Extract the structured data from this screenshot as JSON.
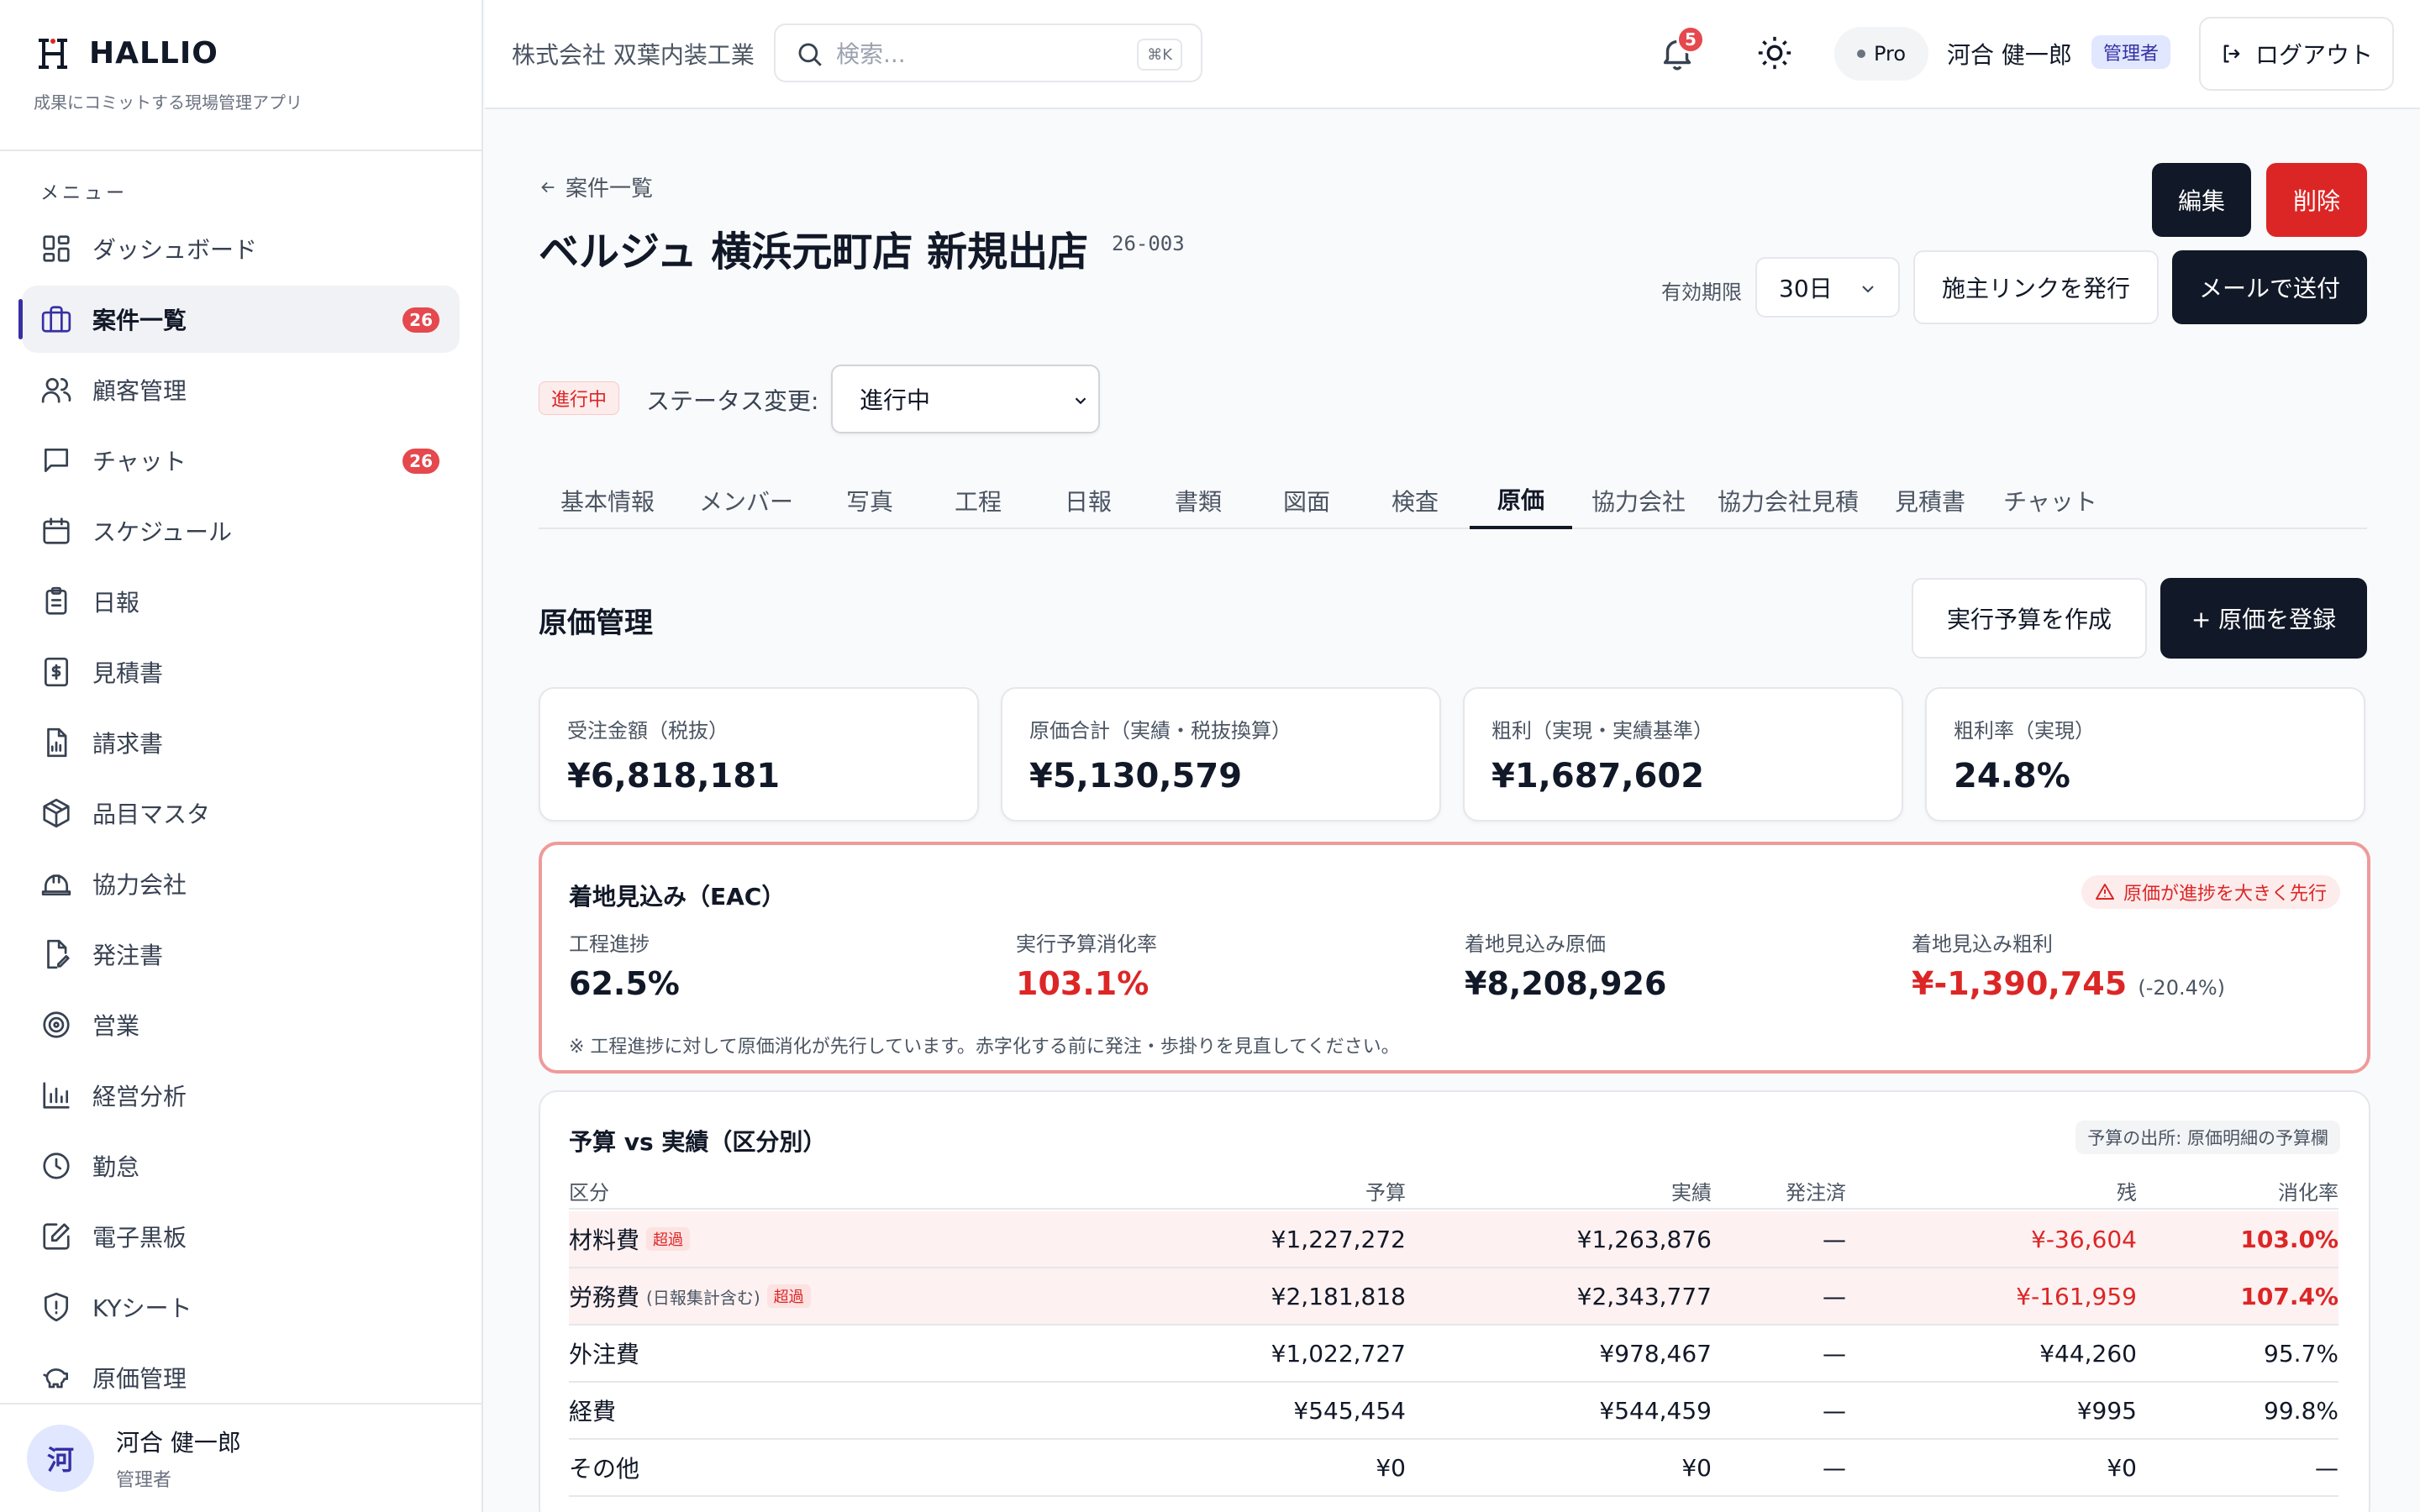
{
  "brand": {
    "name": "HALLIO",
    "tagline": "成果にコミットする現場管理アプリ"
  },
  "sidebar": {
    "menu_title": "メニュー",
    "items": [
      {
        "label": "ダッシュボード",
        "icon": "dashboard-icon"
      },
      {
        "label": "案件一覧",
        "icon": "briefcase-icon",
        "badge": "26",
        "active": true
      },
      {
        "label": "顧客管理",
        "icon": "users-icon"
      },
      {
        "label": "チャット",
        "icon": "chat-icon",
        "badge": "26"
      },
      {
        "label": "スケジュール",
        "icon": "calendar-icon"
      },
      {
        "label": "日報",
        "icon": "clipboard-icon"
      },
      {
        "label": "見積書",
        "icon": "dollar-file-icon"
      },
      {
        "label": "請求書",
        "icon": "invoice-icon"
      },
      {
        "label": "品目マスタ",
        "icon": "box-icon"
      },
      {
        "label": "協力会社",
        "icon": "hardhat-icon"
      },
      {
        "label": "発注書",
        "icon": "edit-file-icon"
      },
      {
        "label": "営業",
        "icon": "target-icon"
      },
      {
        "label": "経営分析",
        "icon": "bar-chart-icon"
      },
      {
        "label": "勤怠",
        "icon": "clock-icon"
      },
      {
        "label": "電子黒板",
        "icon": "pen-square-icon"
      },
      {
        "label": "KYシート",
        "icon": "shield-alert-icon"
      },
      {
        "label": "原価管理",
        "icon": "piggy-bank-icon"
      }
    ],
    "user": {
      "initial": "河",
      "name": "河合 健一郎",
      "role": "管理者"
    }
  },
  "topbar": {
    "company": "株式会社 双葉内装工業",
    "search_placeholder": "検索...",
    "shortcut": "⌘K",
    "notifications": "5",
    "plan": "Pro",
    "user_name": "河合 健一郎",
    "user_badge": "管理者",
    "logout": "ログアウト"
  },
  "project": {
    "back": "案件一覧",
    "title": "ベルジュ 横浜元町店 新規出店",
    "code": "26-003",
    "edit": "編集",
    "delete": "削除",
    "expire_label": "有効期限",
    "expire_value": "30日",
    "issue_link": "施主リンクを発行",
    "send_mail": "メールで送付",
    "status_badge": "進行中",
    "status_label": "ステータス変更:",
    "status_value": "進行中"
  },
  "tabs": [
    "基本情報",
    "メンバー",
    "写真",
    "工程",
    "日報",
    "書類",
    "図面",
    "検査",
    "原価",
    "協力会社",
    "協力会社見積",
    "見積書",
    "チャット"
  ],
  "active_tab": "原価",
  "cost": {
    "title": "原価管理",
    "create_budget": "実行予算を作成",
    "register_cost": "+ 原価を登録",
    "kpis": [
      {
        "label": "受注金額（税抜）",
        "value": "¥6,818,181"
      },
      {
        "label": "原価合計（実績・税抜換算）",
        "value": "¥5,130,579"
      },
      {
        "label": "粗利（実現・実績基準）",
        "value": "¥1,687,602"
      },
      {
        "label": "粗利率（実現）",
        "value": "24.8%"
      }
    ],
    "eac": {
      "title": "着地見込み（EAC）",
      "warning": "原価が進捗を大きく先行",
      "progress_label": "工程進捗",
      "progress_value": "62.5%",
      "consumption_label": "実行予算消化率",
      "consumption_value": "103.1%",
      "forecast_cost_label": "着地見込み原価",
      "forecast_cost_value": "¥8,208,926",
      "forecast_profit_label": "着地見込み粗利",
      "forecast_profit_value": "¥-1,390,745",
      "forecast_profit_rate": "(-20.4%)",
      "note": "※ 工程進捗に対して原価消化が先行しています。赤字化する前に発注・歩掛りを見直してください。"
    },
    "budget": {
      "title": "予算 vs 実績（区分別）",
      "source": "予算の出所: 原価明細の予算欄",
      "headers": [
        "区分",
        "予算",
        "実績",
        "発注済",
        "残",
        "消化率"
      ],
      "over_label": "超過",
      "rows": [
        {
          "name": "材料費",
          "note": "",
          "budget": "¥1,227,272",
          "actual": "¥1,263,876",
          "ordered": "—",
          "remain": "¥-36,604",
          "rate": "103.0%",
          "over": true
        },
        {
          "name": "労務費",
          "note": "(日報集計含む)",
          "budget": "¥2,181,818",
          "actual": "¥2,343,777",
          "ordered": "—",
          "remain": "¥-161,959",
          "rate": "107.4%",
          "over": true
        },
        {
          "name": "外注費",
          "note": "",
          "budget": "¥1,022,727",
          "actual": "¥978,467",
          "ordered": "—",
          "remain": "¥44,260",
          "rate": "95.7%",
          "over": false
        },
        {
          "name": "経費",
          "note": "",
          "budget": "¥545,454",
          "actual": "¥544,459",
          "ordered": "—",
          "remain": "¥995",
          "rate": "99.8%",
          "over": false
        },
        {
          "name": "その他",
          "note": "",
          "budget": "¥0",
          "actual": "¥0",
          "ordered": "—",
          "remain": "¥0",
          "rate": "—",
          "over": false
        }
      ]
    }
  },
  "colors": {
    "accent": "#3730a3",
    "danger": "#dc2626",
    "dark": "#111827"
  }
}
